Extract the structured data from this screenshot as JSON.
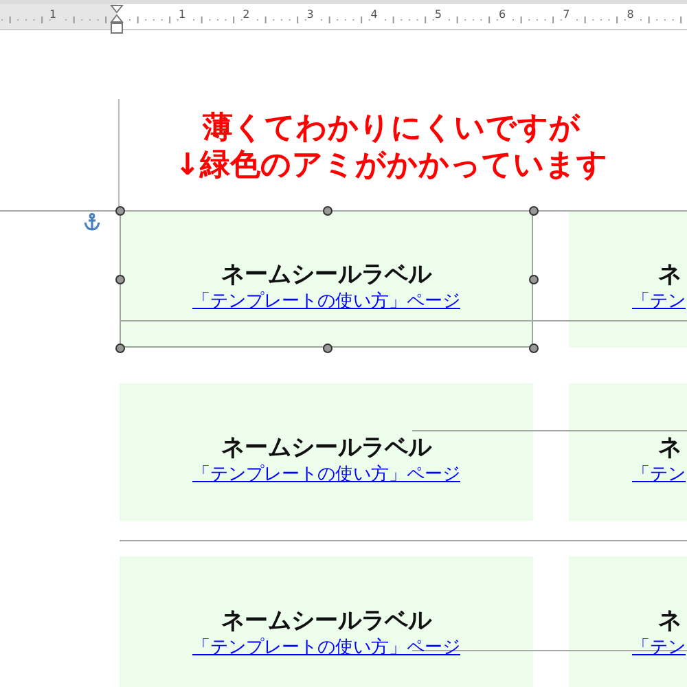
{
  "ruler": {
    "labels": [
      "1",
      "1",
      "2",
      "3",
      "4",
      "5",
      "6",
      "7",
      "8"
    ]
  },
  "annotation": {
    "lines": [
      "薄くてわかりにくいですが",
      "↓緑色のアミがかかっています"
    ]
  },
  "labels": [
    {
      "title": "ネームシールラベル",
      "link": "「テンプレートの使い方」ページ",
      "selected": true,
      "cut": false
    },
    {
      "title": "ネ",
      "link": "「テン",
      "selected": false,
      "cut": true
    },
    {
      "title": "ネームシールラベル",
      "link": "「テンプレートの使い方」ページ",
      "selected": false,
      "cut": false
    },
    {
      "title": "ネ",
      "link": "「テン",
      "selected": false,
      "cut": true
    },
    {
      "title": "ネームシールラベル",
      "link": "「テンプレートの使い方」ページ",
      "selected": false,
      "cut": false
    },
    {
      "title": "ネ",
      "link": "「テン",
      "selected": false,
      "cut": true
    }
  ]
}
